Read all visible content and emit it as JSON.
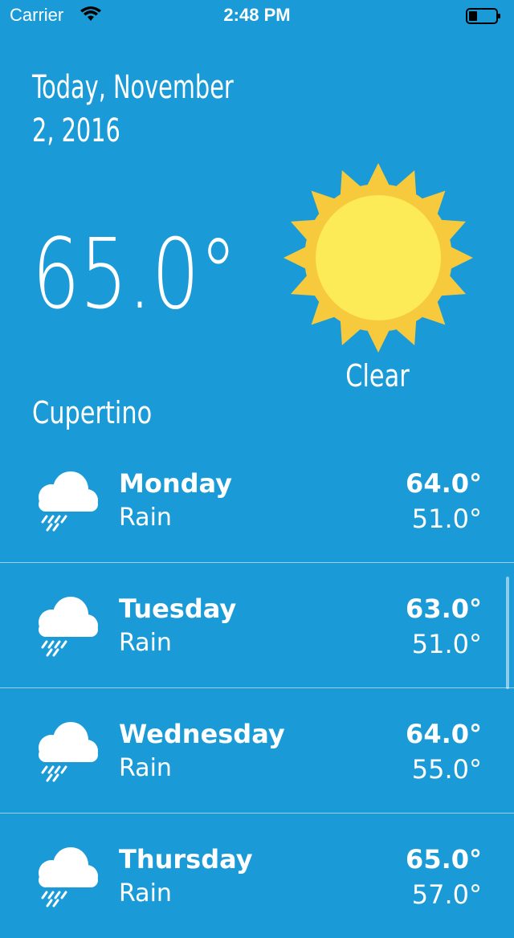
{
  "status_bar": {
    "carrier": "Carrier",
    "time": "2:48 PM"
  },
  "header": {
    "date_line1": "Today, November",
    "date_line2": "2, 2016"
  },
  "current": {
    "temperature": "65.0°",
    "condition": "Clear",
    "city": "Cupertino",
    "icon": "sun-icon"
  },
  "forecast": [
    {
      "day": "Monday",
      "desc": "Rain",
      "high": "64.0°",
      "low": "51.0°",
      "icon": "rain-cloud-icon"
    },
    {
      "day": "Tuesday",
      "desc": "Rain",
      "high": "63.0°",
      "low": "51.0°",
      "icon": "rain-cloud-icon"
    },
    {
      "day": "Wednesday",
      "desc": "Rain",
      "high": "64.0°",
      "low": "55.0°",
      "icon": "rain-cloud-icon"
    },
    {
      "day": "Thursday",
      "desc": "Rain",
      "high": "65.0°",
      "low": "57.0°",
      "icon": "rain-cloud-icon"
    }
  ],
  "colors": {
    "background": "#1a9bd7",
    "sun_outer": "#f7c93c",
    "sun_inner": "#fdea57",
    "text": "#ffffff"
  }
}
